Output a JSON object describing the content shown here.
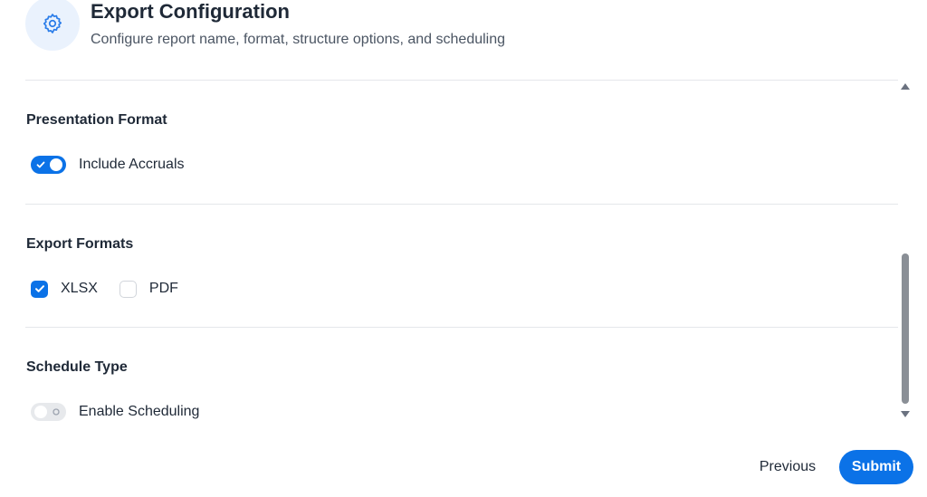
{
  "header": {
    "title": "Export Configuration",
    "subtitle": "Configure report name, format, structure options, and scheduling",
    "icon": "gear-icon"
  },
  "sections": [
    {
      "title": "Presentation Format",
      "toggle": {
        "label": "Include Accruals",
        "on": true
      }
    },
    {
      "title": "Export Formats",
      "options": [
        {
          "label": "XLSX",
          "checked": true
        },
        {
          "label": "PDF",
          "checked": false
        }
      ]
    },
    {
      "title": "Schedule Type",
      "toggle": {
        "label": "Enable Scheduling",
        "on": false
      }
    }
  ],
  "footer": {
    "previous_label": "Previous",
    "submit_label": "Submit"
  },
  "colors": {
    "accent": "#0b72e7",
    "icon_bg": "#eaf2fd",
    "divider": "#e5e7eb"
  }
}
